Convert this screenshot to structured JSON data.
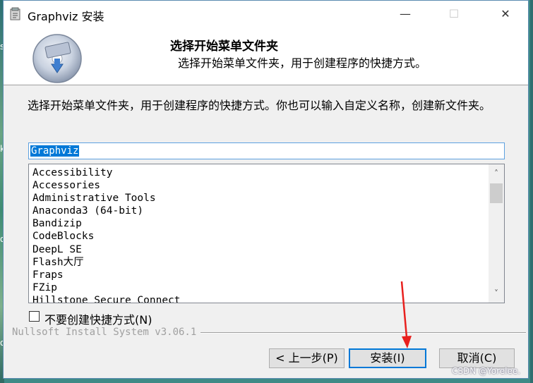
{
  "window": {
    "title": "Graphviz 安装",
    "controls": {
      "minimize": "—",
      "maximize": "☐",
      "close": "✕"
    }
  },
  "header": {
    "title": "选择开始菜单文件夹",
    "subtitle": "选择开始菜单文件夹，用于创建程序的快捷方式。"
  },
  "body": {
    "description": "选择开始菜单文件夹，用于创建程序的快捷方式。你也可以输入自定义名称，创建新文件夹。",
    "folder_input": {
      "value": "Graphviz"
    },
    "list_items": [
      "Accessibility",
      "Accessories",
      "Administrative Tools",
      "Anaconda3 (64-bit)",
      "Bandizip",
      "CodeBlocks",
      "DeepL SE",
      "Flash大厅",
      "Fraps",
      "FZip",
      "Hillstone Secure Connect"
    ],
    "no_shortcut_checkbox": {
      "label": "不要创建快捷方式(N)",
      "checked": false
    }
  },
  "footer": {
    "brand": "Nullsoft Install System v3.06.1",
    "back_label": "< 上一步(P)",
    "install_label": "安装(I)",
    "cancel_label": "取消(C)"
  },
  "overlay": {
    "watermark": "CSDN @Yorelee.",
    "desktop_glyphs": [
      "s",
      "k",
      "o",
      "o"
    ],
    "annotation_color": "#e8201e"
  }
}
